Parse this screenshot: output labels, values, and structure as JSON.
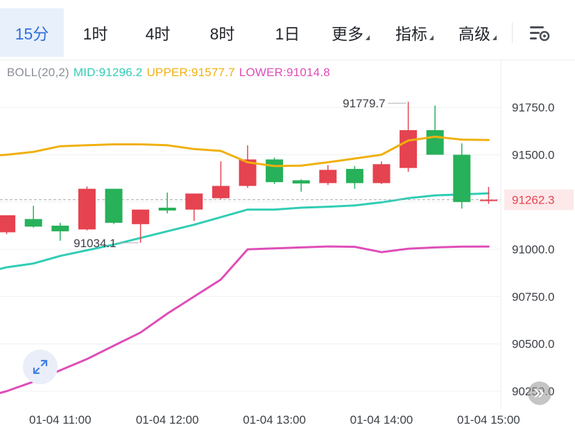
{
  "tabs": [
    {
      "label": "15分",
      "active": true,
      "dropdown": false
    },
    {
      "label": "1时",
      "active": false,
      "dropdown": false
    },
    {
      "label": "4时",
      "active": false,
      "dropdown": false
    },
    {
      "label": "8时",
      "active": false,
      "dropdown": false
    },
    {
      "label": "1日",
      "active": false,
      "dropdown": false
    },
    {
      "label": "更多",
      "active": false,
      "dropdown": true
    },
    {
      "label": "指标",
      "active": false,
      "dropdown": true
    },
    {
      "label": "高级",
      "active": false,
      "dropdown": true
    }
  ],
  "icons": {
    "settings": "chart-settings-icon",
    "expand": "expand-arrows-icon",
    "scroll": "double-chevron-right-icon"
  },
  "indicator": {
    "name": "BOLL(20,2)",
    "mid_label": "MID:91296.2",
    "upper_label": "UPPER:91577.7",
    "lower_label": "LOWER:91014.8"
  },
  "colors": {
    "up": "#e5434f",
    "down": "#27b15a",
    "mid": "#2fcdb4",
    "upper": "#f0b00c",
    "lower": "#df4cb8",
    "accent": "#2f6fd6",
    "price_marker": "#e5434f"
  },
  "chart_data": {
    "type": "candlestick",
    "indicator": "Bollinger Bands (20,2)",
    "y_range": [
      90200,
      92000
    ],
    "y_ticks": [
      90250,
      90500,
      90750,
      91000,
      91250,
      91500,
      91750
    ],
    "y_tick_labels": [
      "90250.0",
      "90500.0",
      "90750.0",
      "91000.0",
      "91250.0",
      "91500.0",
      "91750.0"
    ],
    "x_tick_labels": [
      "01-04 11:00",
      "01-04 12:00",
      "01-04 13:00",
      "01-04 14:00",
      "01-04 15:00"
    ],
    "x_tick_index": [
      3,
      7,
      11,
      15,
      19
    ],
    "candles": [
      {
        "open": 91090,
        "high": 91170,
        "low": 91080,
        "close": 91180
      },
      {
        "open": 91160,
        "high": 91230,
        "low": 91115,
        "close": 91120
      },
      {
        "open": 91125,
        "high": 91140,
        "low": 91045,
        "close": 91095
      },
      {
        "open": 91105,
        "high": 91332,
        "low": 91100,
        "close": 91320
      },
      {
        "open": 91320,
        "high": 91320,
        "low": 91133,
        "close": 91140
      },
      {
        "open": 91133,
        "high": 91200,
        "low": 91034.1,
        "close": 91210
      },
      {
        "open": 91220,
        "high": 91300,
        "low": 91190,
        "close": 91205
      },
      {
        "open": 91210,
        "high": 91250,
        "low": 91150,
        "close": 91295
      },
      {
        "open": 91270,
        "high": 91465,
        "low": 91265,
        "close": 91335
      },
      {
        "open": 91335,
        "high": 91550,
        "low": 91325,
        "close": 91475
      },
      {
        "open": 91475,
        "high": 91485,
        "low": 91345,
        "close": 91355
      },
      {
        "open": 91365,
        "high": 91370,
        "low": 91305,
        "close": 91348
      },
      {
        "open": 91350,
        "high": 91445,
        "low": 91340,
        "close": 91420
      },
      {
        "open": 91425,
        "high": 91440,
        "low": 91320,
        "close": 91350
      },
      {
        "open": 91350,
        "high": 91465,
        "low": 91345,
        "close": 91450
      },
      {
        "open": 91430,
        "high": 91779.7,
        "low": 91410,
        "close": 91630
      },
      {
        "open": 91630,
        "high": 91760,
        "low": 91500,
        "close": 91500
      },
      {
        "open": 91500,
        "high": 91560,
        "low": 91215,
        "close": 91250
      },
      {
        "open": 91260,
        "high": 91330,
        "low": 91240,
        "close": 91262.3
      }
    ],
    "upper": [
      91490,
      91500,
      91515,
      91545,
      91550,
      91555,
      91555,
      91550,
      91530,
      91520,
      91460,
      91440,
      91442,
      91460,
      91480,
      91500,
      91575,
      91595,
      91580,
      91577.7
    ],
    "mid": [
      90870,
      90905,
      90925,
      90965,
      90995,
      91025,
      91060,
      91095,
      91130,
      91170,
      91210,
      91210,
      91220,
      91225,
      91232,
      91248,
      91270,
      91285,
      91290,
      91296.2
    ],
    "lower": [
      90210,
      90250,
      90300,
      90360,
      90420,
      90490,
      90560,
      90660,
      90750,
      90840,
      91000,
      91005,
      91010,
      91015,
      91013,
      90985,
      91003,
      91010,
      91014,
      91014.8
    ],
    "current_price": 91262.3,
    "current_price_label": "91262.3",
    "high_marker": {
      "value": 91779.7,
      "label": "91779.7",
      "candle_index": 15
    },
    "low_marker": {
      "value": 91034.1,
      "label": "91034.1",
      "candle_index": 5
    }
  }
}
